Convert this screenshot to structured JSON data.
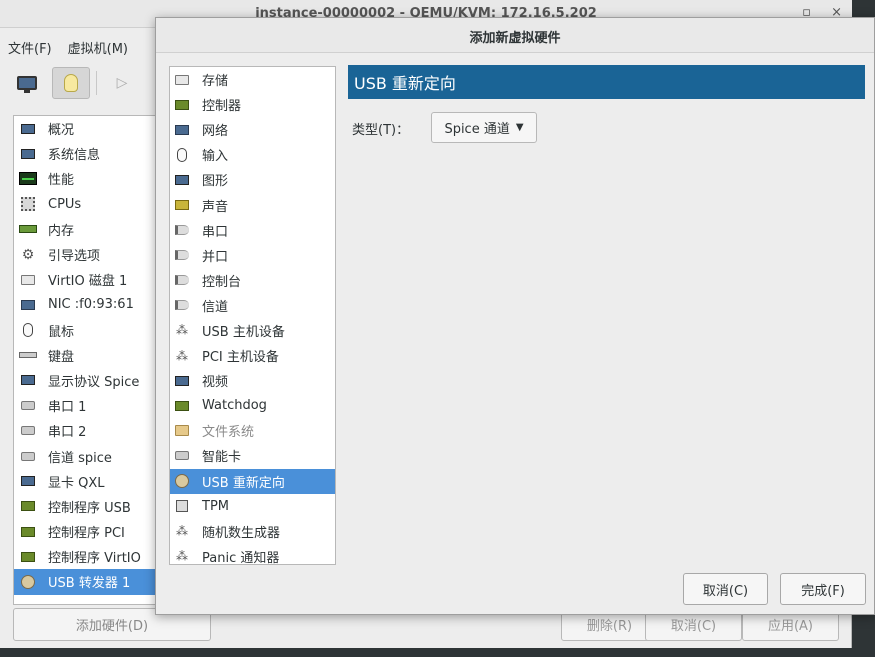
{
  "vm_window": {
    "title": "instance-00000002 - QEMU/KVM: 172.16.5.202",
    "controls": [
      "▫",
      "×"
    ],
    "menu": [
      "文件(F)",
      "虚拟机(M)"
    ],
    "hardware_list": [
      {
        "label": "概况",
        "icon": "monitor-icon"
      },
      {
        "label": "系统信息",
        "icon": "monitor-icon"
      },
      {
        "label": "性能",
        "icon": "chart-icon"
      },
      {
        "label": "CPUs",
        "icon": "cpu-icon"
      },
      {
        "label": "内存",
        "icon": "ram-icon"
      },
      {
        "label": "引导选项",
        "icon": "gear-icon"
      },
      {
        "label": "VirtIO 磁盘 1",
        "icon": "disk-icon"
      },
      {
        "label": "NIC :f0:93:61",
        "icon": "network-icon"
      },
      {
        "label": "鼠标",
        "icon": "mouse-icon"
      },
      {
        "label": "键盘",
        "icon": "keyboard-icon"
      },
      {
        "label": "显示协议 Spice",
        "icon": "monitor-icon"
      },
      {
        "label": "串口 1",
        "icon": "serial-icon"
      },
      {
        "label": "串口 2",
        "icon": "serial-icon"
      },
      {
        "label": "信道 spice",
        "icon": "serial-icon"
      },
      {
        "label": "显卡 QXL",
        "icon": "monitor-icon"
      },
      {
        "label": "控制程序 USB",
        "icon": "controller-icon"
      },
      {
        "label": "控制程序 PCI",
        "icon": "controller-icon"
      },
      {
        "label": "控制程序 VirtIO",
        "icon": "controller-icon"
      },
      {
        "label": "USB 转发器 1",
        "icon": "usb-redirect-icon",
        "selected": true
      }
    ],
    "add_hardware_label": "添加硬件(D)",
    "remove_label": "删除(R)",
    "cancel_label": "取消(C)",
    "apply_label": "应用(A)"
  },
  "dialog": {
    "title": "添加新虚拟硬件",
    "categories": [
      {
        "label": "存储",
        "icon": "disk-icon"
      },
      {
        "label": "控制器",
        "icon": "controller-icon"
      },
      {
        "label": "网络",
        "icon": "network-icon"
      },
      {
        "label": "输入",
        "icon": "mouse-icon"
      },
      {
        "label": "图形",
        "icon": "monitor-icon"
      },
      {
        "label": "声音",
        "icon": "sound-card-icon"
      },
      {
        "label": "串口",
        "icon": "plug-icon"
      },
      {
        "label": "并口",
        "icon": "plug-icon"
      },
      {
        "label": "控制台",
        "icon": "plug-icon"
      },
      {
        "label": "信道",
        "icon": "plug-icon"
      },
      {
        "label": "USB 主机设备",
        "icon": "usb-tree-icon"
      },
      {
        "label": "PCI 主机设备",
        "icon": "usb-tree-icon"
      },
      {
        "label": "视频",
        "icon": "monitor-icon"
      },
      {
        "label": "Watchdog",
        "icon": "controller-icon"
      },
      {
        "label": "文件系统",
        "icon": "folder-icon",
        "disabled": true
      },
      {
        "label": "智能卡",
        "icon": "smartcard-icon"
      },
      {
        "label": "USB 重新定向",
        "icon": "usb-redirect-icon",
        "selected": true
      },
      {
        "label": "TPM",
        "icon": "chip-icon"
      },
      {
        "label": "随机数生成器",
        "icon": "usb-tree-icon"
      },
      {
        "label": "Panic 通知器",
        "icon": "usb-tree-icon"
      }
    ],
    "page_header": "USB 重新定向",
    "type_label": "类型(T)：",
    "type_value": "Spice 通道",
    "cancel_label": "取消(C)",
    "finish_label": "完成(F)"
  },
  "colors": {
    "header_blue": "#1a6496",
    "selection_blue": "#4a90d9",
    "window_bg": "#ededed"
  }
}
